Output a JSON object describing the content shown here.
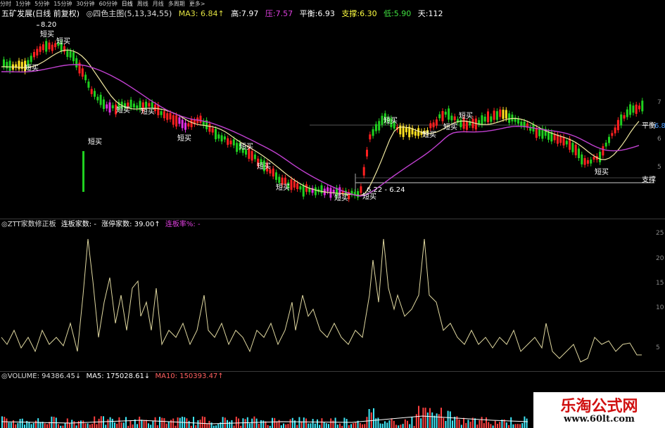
{
  "periods": [
    "分时",
    "1分钟",
    "5分钟",
    "15分钟",
    "30分钟",
    "60分钟",
    "日线",
    "周线",
    "月线",
    "多周期",
    "更多>"
  ],
  "active_period": "日线",
  "header": {
    "stock": "五矿发展(日线 前复权)",
    "indicator": "◎四色主图(5,13,34,55)",
    "ma3": "MA3: 6.84↑",
    "high_label": "高:",
    "high": "7.97",
    "press_label": "压:",
    "press": "7.57",
    "balance_label": "平衡:",
    "balance": "6.93",
    "support_label": "支撑:",
    "support": "6.30",
    "low_label": "低:",
    "low": "5.90",
    "days_label": "天:",
    "days": "112"
  },
  "main_annotations": {
    "peak_price": "8.20",
    "range_text": "6.22 - 6.24",
    "short_buy": "短买",
    "balance_tag": "平衡",
    "balance_value": "6.8",
    "support_tag": "支撑"
  },
  "panel2": {
    "title": "◎ZTT家数修正板",
    "lianban": "连板家数: -",
    "zhangting": "涨停家数: 39.00↑",
    "rate": "连板率%: -"
  },
  "panel3": {
    "volume": "◎VOLUME: 94386.45↓",
    "ma5": "MA5: 175028.61↓",
    "ma10": "MA10: 150393.47↑"
  },
  "y_ticks_main": [
    "7",
    "6",
    "5"
  ],
  "y_ticks_sub": [
    "25",
    "20",
    "15",
    "10",
    "5"
  ],
  "watermark": {
    "cn": "乐淘公式网",
    "url": "www.60lt.com"
  },
  "colors": {
    "up": "#ff2020",
    "down": "#20d020",
    "yellow": "#ffe020",
    "magenta": "#e030e0",
    "ma_yellow": "#f0e8a0",
    "ma_pink": "#c040d0",
    "line": "#e0d8a0"
  }
}
